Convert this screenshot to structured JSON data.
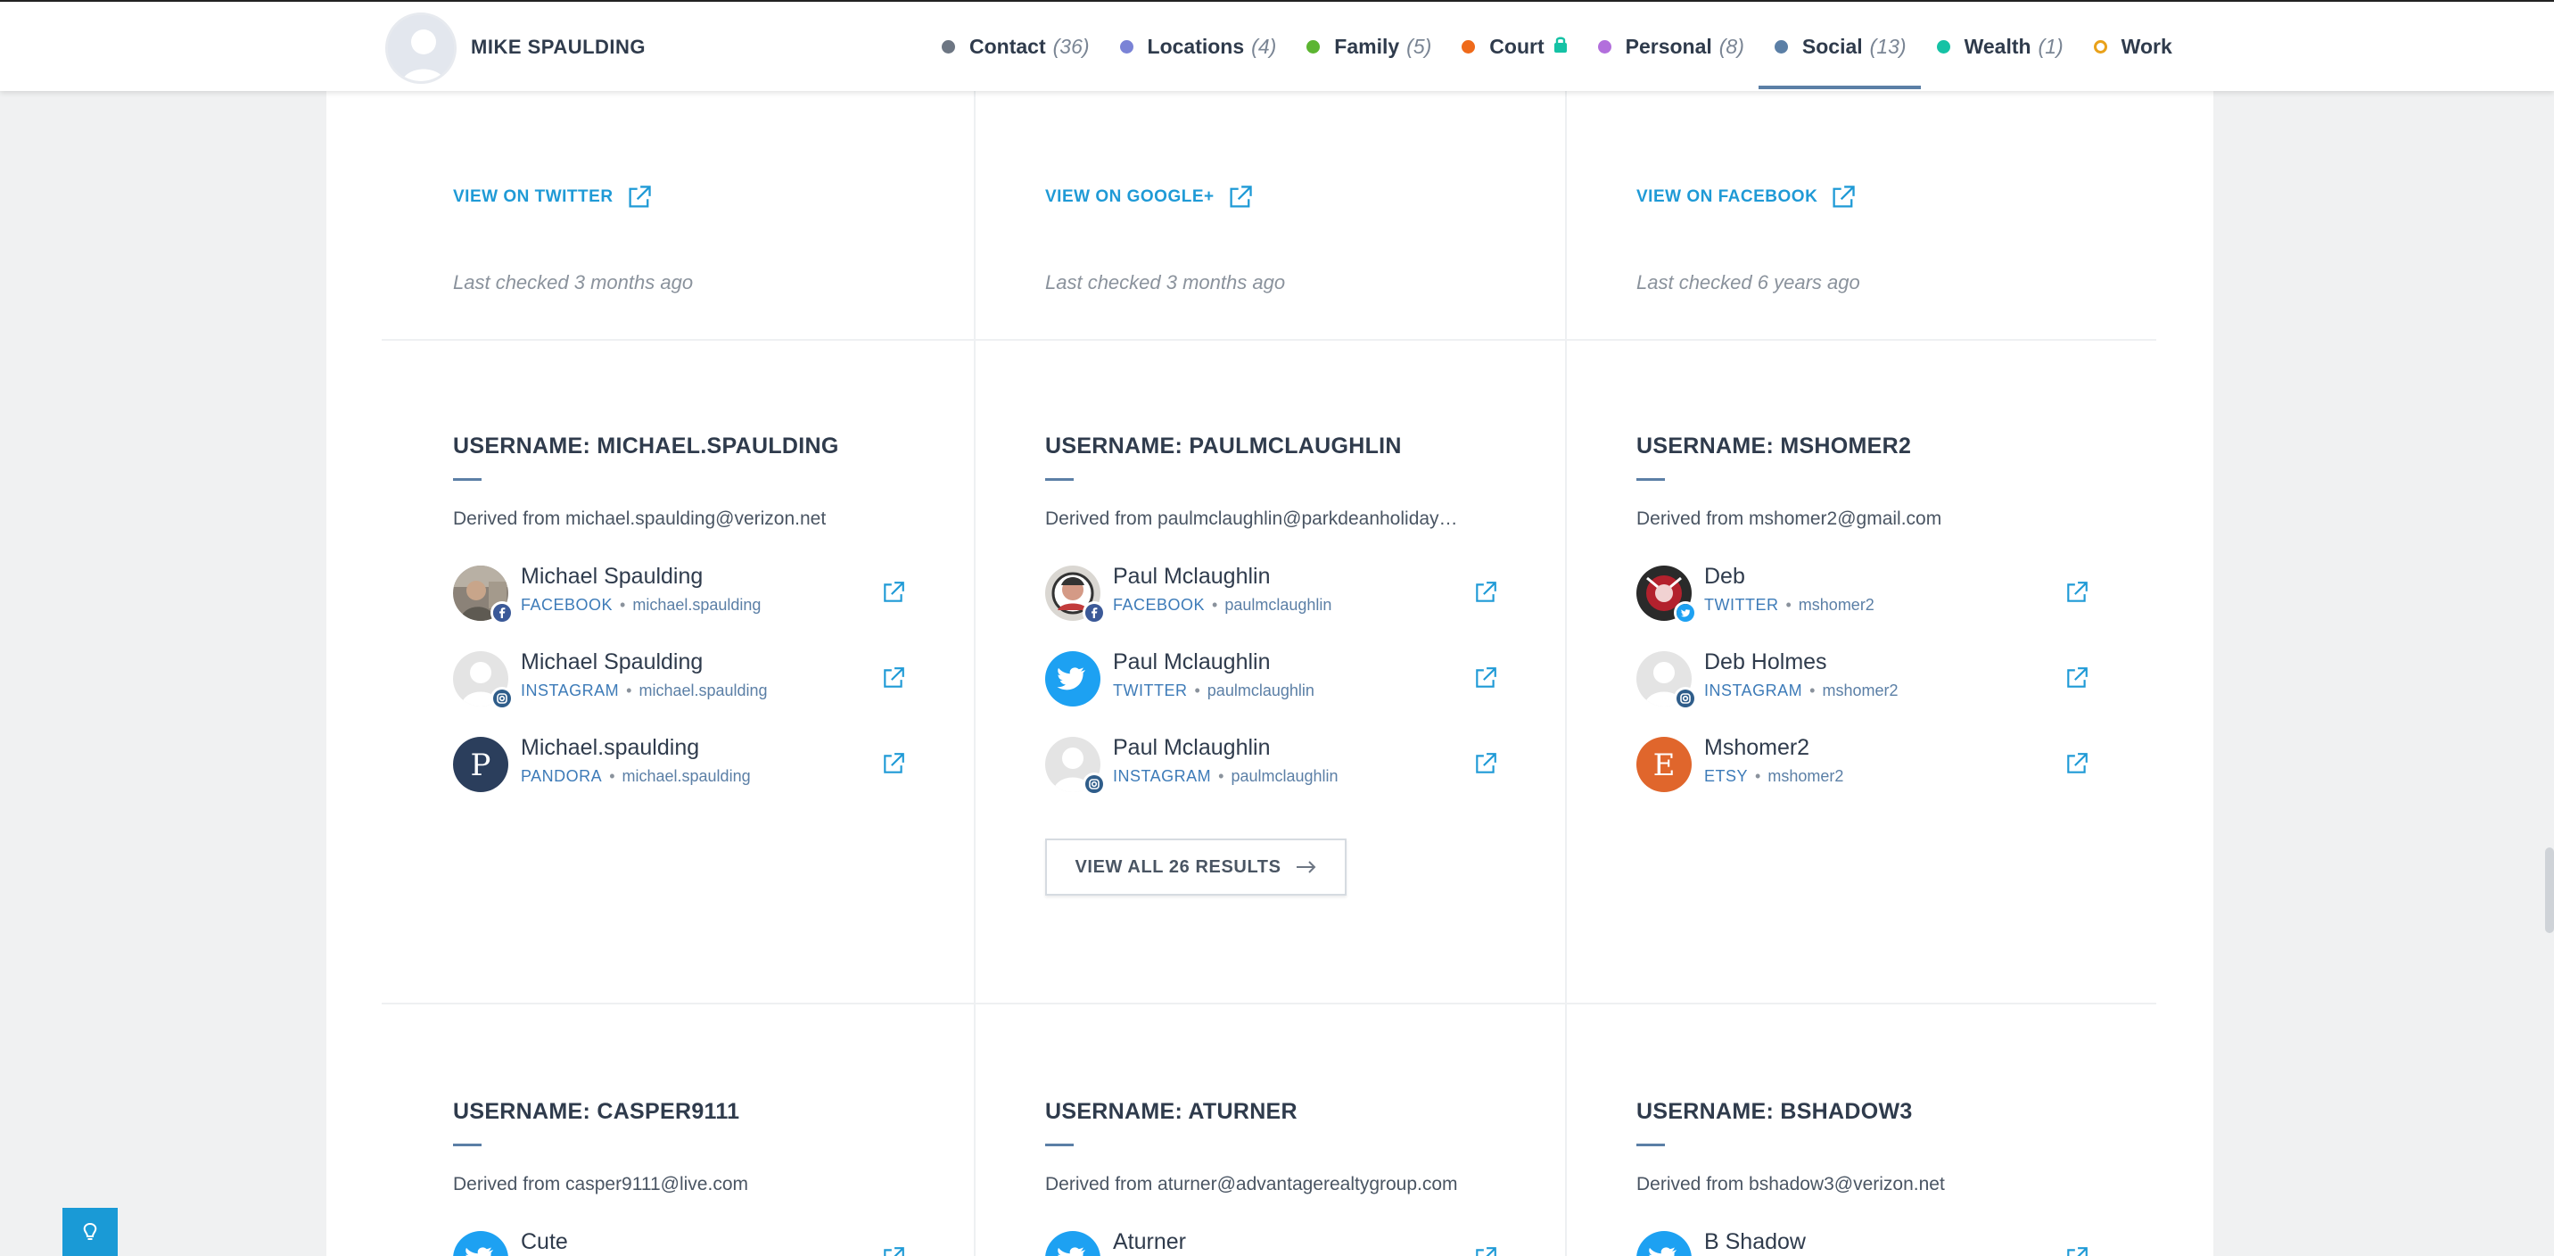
{
  "header": {
    "person_name": "MIKE SPAULDING",
    "nav": [
      {
        "label": "Contact",
        "count": "(36)",
        "color": "#6d7683",
        "hollow": false,
        "active": false,
        "locked": false
      },
      {
        "label": "Locations",
        "count": "(4)",
        "color": "#7a83d6",
        "hollow": false,
        "active": false,
        "locked": false
      },
      {
        "label": "Family",
        "count": "(5)",
        "color": "#5cb531",
        "hollow": false,
        "active": false,
        "locked": false
      },
      {
        "label": "Court",
        "count": "",
        "color": "#ef6a1a",
        "hollow": false,
        "active": false,
        "locked": true
      },
      {
        "label": "Personal",
        "count": "(8)",
        "color": "#b26fdc",
        "hollow": false,
        "active": false,
        "locked": false
      },
      {
        "label": "Social",
        "count": "(13)",
        "color": "#5b7fa6",
        "hollow": false,
        "active": true,
        "locked": false
      },
      {
        "label": "Wealth",
        "count": "(1)",
        "color": "#15c2a5",
        "hollow": false,
        "active": false,
        "locked": false
      },
      {
        "label": "Work",
        "count": "",
        "color": "#e9a11a",
        "hollow": true,
        "active": false,
        "locked": false
      }
    ]
  },
  "top_row": [
    {
      "link": "VIEW ON TWITTER",
      "checked": "Last checked 3 months ago"
    },
    {
      "link": "VIEW ON GOOGLE+",
      "checked": "Last checked 3 months ago"
    },
    {
      "link": "VIEW ON FACEBOOK",
      "checked": "Last checked 6 years ago"
    }
  ],
  "username_groups": [
    {
      "heading": "USERNAME: MICHAEL.SPAULDING",
      "derived": "Derived from michael.spaulding@verizon.net",
      "results": [
        {
          "name": "Michael Spaulding",
          "source": "FACEBOOK",
          "user": "michael.spaulding",
          "avatar": "photo-old",
          "badge": "facebook"
        },
        {
          "name": "Michael Spaulding",
          "source": "INSTAGRAM",
          "user": "michael.spaulding",
          "avatar": "placeholder",
          "badge": "instagram"
        },
        {
          "name": "Michael.spaulding",
          "source": "PANDORA",
          "user": "michael.spaulding",
          "avatar": "letter",
          "letter": "P",
          "badge": ""
        }
      ]
    },
    {
      "heading": "USERNAME: PAULMCLAUGHLIN",
      "derived": "Derived from paulmclaughlin@parkdeanholiday…",
      "results": [
        {
          "name": "Paul Mclaughlin",
          "source": "FACEBOOK",
          "user": "paulmclaughlin",
          "avatar": "photo-face",
          "badge": "facebook"
        },
        {
          "name": "Paul Mclaughlin",
          "source": "TWITTER",
          "user": "paulmclaughlin",
          "avatar": "twitter",
          "badge": ""
        },
        {
          "name": "Paul Mclaughlin",
          "source": "INSTAGRAM",
          "user": "paulmclaughlin",
          "avatar": "placeholder",
          "badge": "instagram"
        }
      ],
      "view_all": "VIEW ALL 26 RESULTS"
    },
    {
      "heading": "USERNAME: MSHOMER2",
      "derived": "Derived from mshomer2@gmail.com",
      "results": [
        {
          "name": "Deb",
          "source": "TWITTER",
          "user": "mshomer2",
          "avatar": "photo-red",
          "badge": "twitter"
        },
        {
          "name": "Deb Holmes",
          "source": "INSTAGRAM",
          "user": "mshomer2",
          "avatar": "placeholder",
          "badge": "instagram"
        },
        {
          "name": "Mshomer2",
          "source": "ETSY",
          "user": "mshomer2",
          "avatar": "letter",
          "letter": "E",
          "badge": ""
        }
      ]
    },
    {
      "heading": "USERNAME: CASPER9111",
      "derived": "Derived from casper9111@live.com",
      "results": [
        {
          "name": "Cute",
          "source": "TWITTER",
          "user": "",
          "avatar": "twitter",
          "badge": ""
        }
      ]
    },
    {
      "heading": "USERNAME: ATURNER",
      "derived": "Derived from aturner@advantagerealtygroup.com",
      "results": [
        {
          "name": "Aturner",
          "source": "TWITTER",
          "user": "",
          "avatar": "twitter",
          "badge": ""
        }
      ]
    },
    {
      "heading": "USERNAME: BSHADOW3",
      "derived": "Derived from bshadow3@verizon.net",
      "results": [
        {
          "name": "B Shadow",
          "source": "TWITTER",
          "user": "",
          "avatar": "twitter",
          "badge": ""
        }
      ]
    }
  ],
  "colors": {
    "link": "#1f9ad6",
    "pandora": "#2b3e5c",
    "etsy": "#e0662c",
    "twitter": "#1da1f2",
    "facebook": "#3b5998",
    "instagram": "#2f5d8a"
  }
}
